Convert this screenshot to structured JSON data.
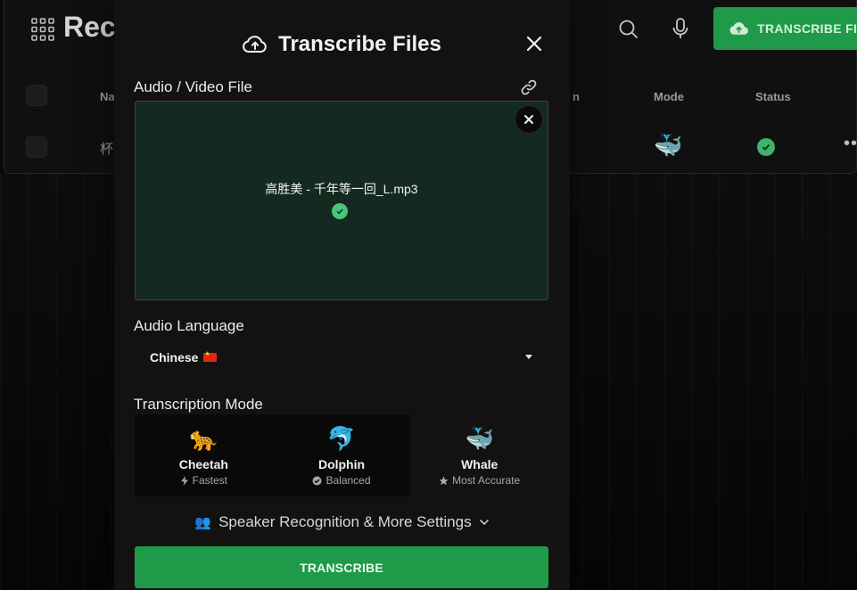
{
  "background": {
    "page_title": "Rece",
    "columns": {
      "name": "Na",
      "mode": "Mode",
      "status": "Status",
      "partial": "n"
    },
    "row": {
      "name": "杯",
      "more": "••"
    },
    "transcribe_button": "TRANSCRIBE FIL"
  },
  "modal": {
    "title": "Transcribe Files",
    "file_section_label": "Audio / Video File",
    "filename": "高胜美 - 千年等一回_L.mp3",
    "language_label": "Audio Language",
    "language_value": "Chinese",
    "mode_label": "Transcription Mode",
    "modes": [
      {
        "name": "Cheetah",
        "sub": "Fastest",
        "emoji": "🐆",
        "sub_icon": "bolt-icon"
      },
      {
        "name": "Dolphin",
        "sub": "Balanced",
        "emoji": "🐬",
        "sub_icon": "check-circle-icon"
      },
      {
        "name": "Whale",
        "sub": "Most Accurate",
        "emoji": "🐳",
        "sub_icon": "star-icon"
      }
    ],
    "settings_toggle": "Speaker Recognition & More Settings",
    "settings_emoji": "👥",
    "submit_label": "TRANSCRIBE"
  },
  "colors": {
    "accent_green": "#1f9a48",
    "dropzone_bg": "#14291f",
    "modal_bg": "#141210"
  }
}
